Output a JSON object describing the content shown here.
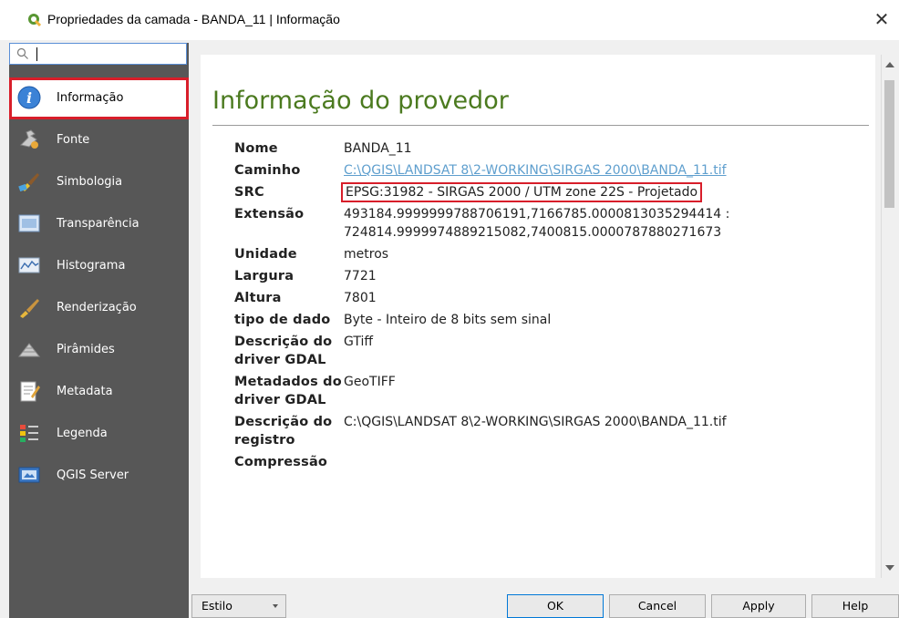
{
  "window": {
    "title": "Propriedades da camada - BANDA_11 | Informação",
    "close_symbol": "✕"
  },
  "search": {
    "value": ""
  },
  "sidebar": {
    "items": [
      {
        "label": "Informação",
        "icon": "info-icon",
        "active": true
      },
      {
        "label": "Fonte",
        "icon": "source-wrench-icon"
      },
      {
        "label": "Simbologia",
        "icon": "symbology-paintbrush-icon"
      },
      {
        "label": "Transparência",
        "icon": "transparency-icon"
      },
      {
        "label": "Histograma",
        "icon": "histogram-icon"
      },
      {
        "label": "Renderização",
        "icon": "rendering-brush-icon"
      },
      {
        "label": "Pirâmides",
        "icon": "pyramids-icon"
      },
      {
        "label": "Metadata",
        "icon": "metadata-icon"
      },
      {
        "label": "Legenda",
        "icon": "legend-icon"
      },
      {
        "label": "QGIS Server",
        "icon": "qgis-server-icon"
      }
    ]
  },
  "main": {
    "heading": "Informação do provedor",
    "rows": [
      {
        "key": "Nome",
        "value": "BANDA_11"
      },
      {
        "key": "Caminho",
        "value": "C:\\QGIS\\LANDSAT 8\\2-WORKING\\SIRGAS 2000\\BANDA_11.tif"
      },
      {
        "key": "SRC",
        "value": "EPSG:31982 - SIRGAS 2000 / UTM zone 22S - Projetado"
      },
      {
        "key": "Extensão",
        "value": "493184.9999999788706191,7166785.0000813035294414 :",
        "value2": "724814.9999974889215082,7400815.0000787880271673"
      },
      {
        "key": "Unidade",
        "value": "metros"
      },
      {
        "key": "Largura",
        "value": "7721"
      },
      {
        "key": "Altura",
        "value": "7801"
      },
      {
        "key": "tipo de dado",
        "value": "Byte - Inteiro de 8 bits sem sinal"
      },
      {
        "key": "Descrição do driver GDAL",
        "value": "GTiff"
      },
      {
        "key": "Metadados do driver GDAL",
        "value": "GeoTIFF"
      },
      {
        "key": "Descrição do registro",
        "value": "C:\\QGIS\\LANDSAT 8\\2-WORKING\\SIRGAS 2000\\BANDA_11.tif"
      },
      {
        "key": "Compressão",
        "value": ""
      }
    ]
  },
  "buttons": {
    "style": "Estilo",
    "ok": "OK",
    "cancel": "Cancel",
    "apply": "Apply",
    "help": "Help"
  },
  "colors": {
    "heading": "#4b7a1f",
    "highlight": "#d81e2a",
    "sidebar_bg": "#575757",
    "link": "#5f9fce"
  }
}
